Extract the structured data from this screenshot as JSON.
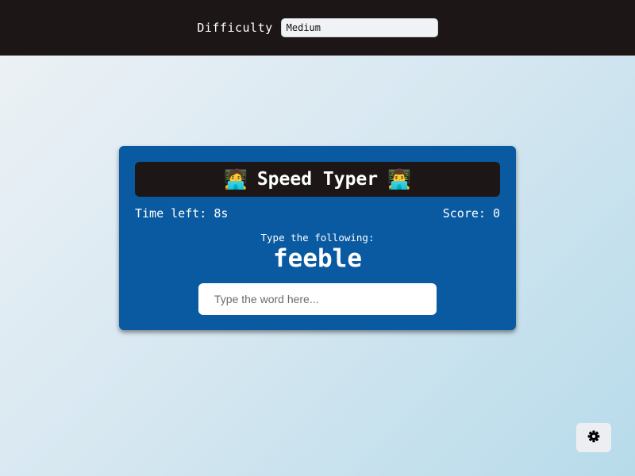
{
  "header": {
    "difficulty_label": "Difficulty",
    "difficulty_selected": "Medium"
  },
  "game": {
    "title": "Speed Typer",
    "title_emoji_left": "🧑‍💻",
    "title_emoji_right": "👨‍💻",
    "time_left": "Time left: 8s",
    "score": "Score: 0",
    "prompt": "Type the following:",
    "word": "feeble",
    "input_placeholder": "Type the word here...",
    "input_value": ""
  },
  "settings": {
    "icon": "gear-icon"
  },
  "colors": {
    "topbar": "#1c1716",
    "card": "#0a5aa2",
    "title_bar": "#1c1716",
    "text": "#ffffff"
  }
}
